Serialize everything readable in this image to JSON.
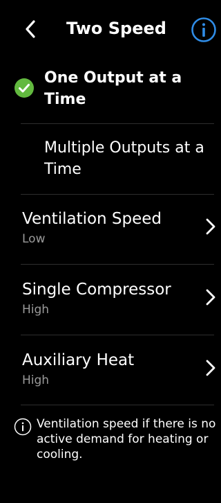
{
  "header": {
    "title": "Two Speed",
    "back_icon": "chevron-left-icon",
    "info_icon": "info-circle-icon"
  },
  "options": [
    {
      "label": "One Output at a Time",
      "selected": true
    },
    {
      "label": "Multiple Outputs at a Time",
      "selected": false
    }
  ],
  "settings": [
    {
      "title": "Ventilation Speed",
      "value": "Low"
    },
    {
      "title": "Single Compressor",
      "value": "High"
    },
    {
      "title": "Auxiliary Heat",
      "value": "High"
    }
  ],
  "footnote": {
    "text": "Ventilation speed if there is no active demand for heating or cooling.",
    "icon": "info-circle-icon"
  },
  "colors": {
    "background": "#000000",
    "text": "#ffffff",
    "secondary_text": "#9a9a9a",
    "accent_blue": "#2f8ce6",
    "check_green": "#62b93f",
    "divider": "#2e2e2e"
  }
}
